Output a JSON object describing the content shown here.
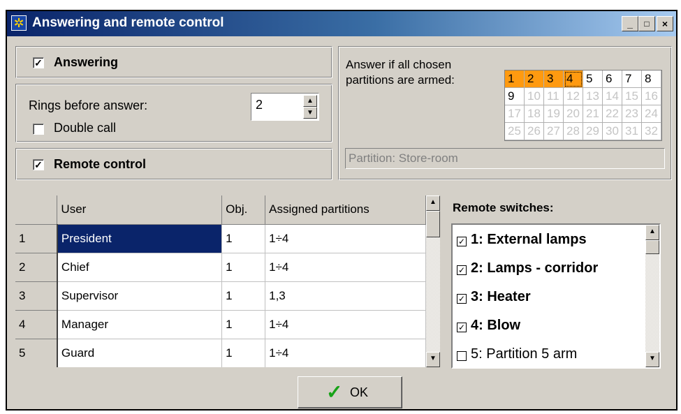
{
  "window": {
    "title": "Answering and remote control",
    "minimize": "_",
    "maximize": "□",
    "close": "×"
  },
  "answering": {
    "label": "Answering",
    "checked": true
  },
  "rings": {
    "label": "Rings before answer:",
    "value": "2"
  },
  "double_call": {
    "label": "Double call",
    "checked": false
  },
  "remote_control": {
    "label": "Remote control",
    "checked": true
  },
  "partitions": {
    "label_line1": "Answer if all chosen",
    "label_line2": "partitions are armed:",
    "cells": [
      "1",
      "2",
      "3",
      "4",
      "5",
      "6",
      "7",
      "8",
      "9",
      "10",
      "11",
      "12",
      "13",
      "14",
      "15",
      "16",
      "17",
      "18",
      "19",
      "20",
      "21",
      "22",
      "23",
      "24",
      "25",
      "26",
      "27",
      "28",
      "29",
      "30",
      "31",
      "32"
    ],
    "armed": [
      "1",
      "2",
      "3",
      "4"
    ],
    "enabled": [
      "5",
      "6",
      "7",
      "8",
      "9"
    ],
    "focused": "4",
    "info": "Partition: Store-room",
    "armed_color": "#ff9a10"
  },
  "users_table": {
    "headers": [
      "",
      "User",
      "Obj.",
      "Assigned partitions"
    ],
    "rows": [
      [
        "1",
        "President",
        "1",
        "1÷4"
      ],
      [
        "2",
        "Chief",
        "1",
        "1÷4"
      ],
      [
        "3",
        "Supervisor",
        "1",
        "1,3"
      ],
      [
        "4",
        "Manager",
        "1",
        "1÷4"
      ],
      [
        "5",
        "Guard",
        "1",
        "1÷4"
      ]
    ],
    "selected_row": 0,
    "selection_color": "#0a246a"
  },
  "remote_switches": {
    "title": "Remote switches:",
    "items": [
      {
        "label": "1: External lamps",
        "checked": true,
        "bold": true
      },
      {
        "label": "2: Lamps - corridor",
        "checked": true,
        "bold": true
      },
      {
        "label": "3: Heater",
        "checked": true,
        "bold": true
      },
      {
        "label": "4: Blow",
        "checked": true,
        "bold": true
      },
      {
        "label": "5: Partition 5 arm",
        "checked": false,
        "bold": false
      }
    ]
  },
  "ok_button": {
    "label": "OK",
    "icon": "checkmark-icon",
    "icon_color": "#17a217"
  },
  "icons": {
    "check": "✓",
    "up": "▲",
    "down": "▼",
    "spin_up": "▲",
    "spin_down": "▼"
  }
}
